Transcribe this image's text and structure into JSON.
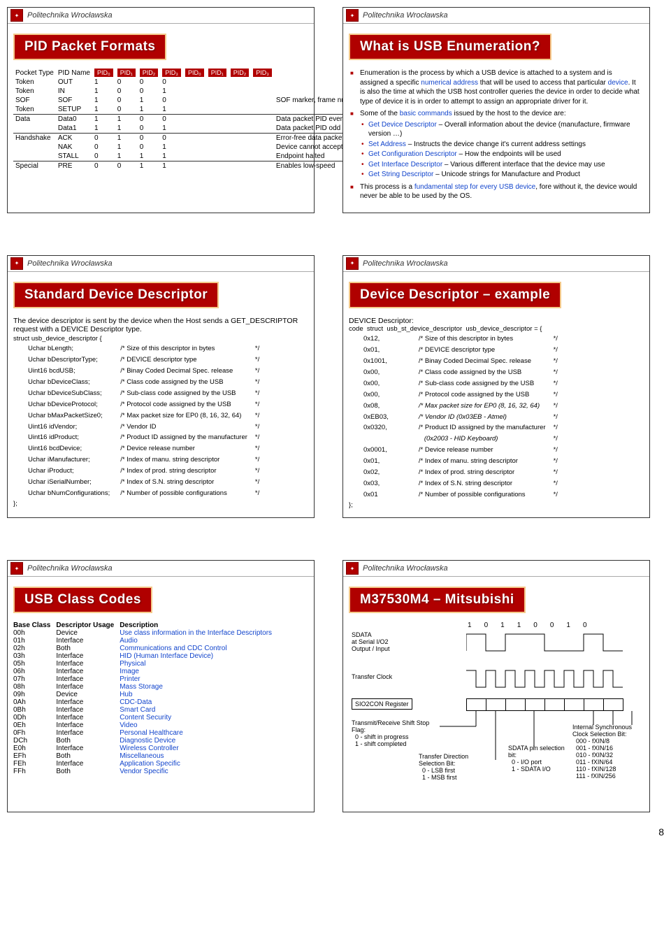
{
  "institution": "Politechnika Wrocławska",
  "page_number": "8",
  "slide1": {
    "title": "PID Packet Formats",
    "col_pt": "Pocket Type",
    "col_pid": "PID Name",
    "pid_headers": [
      "PID₀",
      "PID₁",
      "PID₂",
      "PID₃",
      "PID₀",
      "PID₁",
      "PID₂",
      "PID₃"
    ],
    "rows": [
      {
        "t": "Token",
        "n": "OUT",
        "b": [
          "1",
          "0",
          "0",
          "0"
        ],
        "d": ""
      },
      {
        "t": "Token",
        "n": "IN",
        "b": [
          "1",
          "0",
          "0",
          "1"
        ],
        "d": ""
      },
      {
        "t": "SOF",
        "n": "SOF",
        "b": [
          "1",
          "0",
          "1",
          "0"
        ],
        "d": "SOF marker, frame number"
      },
      {
        "t": "Token",
        "n": "SETUP",
        "b": [
          "1",
          "0",
          "1",
          "1"
        ],
        "d": ""
      },
      {
        "t": "Data",
        "n": "Data0",
        "b": [
          "1",
          "1",
          "0",
          "0"
        ],
        "d": "Data packet PID even"
      },
      {
        "t": "",
        "n": "Data1",
        "b": [
          "1",
          "1",
          "0",
          "1"
        ],
        "d": "Data packet PID odd"
      },
      {
        "t": "Handshake",
        "n": "ACK",
        "b": [
          "0",
          "1",
          "0",
          "0"
        ],
        "d": "Error-free data packet"
      },
      {
        "t": "",
        "n": "NAK",
        "b": [
          "0",
          "1",
          "0",
          "1"
        ],
        "d": "Device cannot accept or send data"
      },
      {
        "t": "",
        "n": "STALL",
        "b": [
          "0",
          "1",
          "1",
          "1"
        ],
        "d": "Endpoint halted"
      },
      {
        "t": "Special",
        "n": "PRE",
        "b": [
          "0",
          "0",
          "1",
          "1"
        ],
        "d": "Enables low-speed"
      }
    ]
  },
  "slide2": {
    "title": "What is USB Enumeration?",
    "para1_a": "Enumeration is the process by which a USB device is attached to a system and is assigned a specific ",
    "para1_b": "numerical address",
    "para1_c": " that will be used to access that particular ",
    "para1_d": "device",
    "para1_e": ". It is also the time at which the USB host controller queries the device in order to decide what type of device it is in order to attempt to assign an appropriate driver for it.",
    "para2_a": "Some of the ",
    "para2_b": "basic commands",
    "para2_c": " issued by the host to the device are:",
    "cmds": [
      {
        "k": "Get Device Descriptor",
        "v": " – Overall information about the device (manufacture, firmware version …)"
      },
      {
        "k": "Set Address",
        "v": " – Instructs the device change it's current address settings"
      },
      {
        "k": "Get Configuration Descriptor",
        "v": " – How the endpoints will be used"
      },
      {
        "k": "Get Interface Descriptor",
        "v": " – Various different interface that the device may use"
      },
      {
        "k": "Get String Descriptor",
        "v": " – Unicode strings for Manufacture and Product"
      }
    ],
    "para3_a": "This process is a ",
    "para3_b": "fundamental step for every USB device",
    "para3_c": ", fore without it, the device would never be able to be used by the OS."
  },
  "slide3": {
    "title": "Standard Device Descriptor",
    "intro": "The device descriptor is sent by the device when the Host sends a GET_DESCRIPTOR request with a DEVICE Descriptor type.",
    "struct_open": "struct usb_device_descriptor {",
    "fields": [
      {
        "n": "Uchar bLength;",
        "c": "/* Size of this descriptor in bytes"
      },
      {
        "n": "Uchar bDescriptorType;",
        "c": "/* DEVICE descriptor type"
      },
      {
        "n": "Uint16 bcdUSB;",
        "c": "/* Binay Coded Decimal Spec. release"
      },
      {
        "n": "Uchar bDeviceClass;",
        "c": "/* Class code assigned by the USB"
      },
      {
        "n": "Uchar bDeviceSubClass;",
        "c": "/* Sub-class code assigned by the USB"
      },
      {
        "n": "Uchar bDeviceProtocol;",
        "c": "/* Protocol code assigned by the USB"
      },
      {
        "n": "Uchar bMaxPacketSize0;",
        "c": "/* Max packet size for EP0 (8, 16, 32, 64)"
      },
      {
        "n": "Uint16 idVendor;",
        "c": "/* Vendor ID"
      },
      {
        "n": "Uint16 idProduct;",
        "c": "/* Product ID assigned by the manufacturer"
      },
      {
        "n": "Uint16 bcdDevice;",
        "c": "/* Device release number"
      },
      {
        "n": "Uchar iManufacturer;",
        "c": "/* Index of manu. string descriptor"
      },
      {
        "n": "Uchar iProduct;",
        "c": "/* Index of prod. string descriptor"
      },
      {
        "n": "Uchar iSerialNumber;",
        "c": "/* Index of S.N. string descriptor"
      },
      {
        "n": "Uchar bNumConfigurations;",
        "c": "/* Number of possible configurations"
      }
    ],
    "struct_close": "};"
  },
  "slide4": {
    "title": "Device Descriptor – example",
    "head": "DEVICE Descriptor:",
    "struct_open": "code  struct  usb_st_device_descriptor  usb_device_descriptor = {",
    "rows": [
      {
        "v": "0x12,",
        "c": "/* Size of this descriptor in bytes"
      },
      {
        "v": "0x01,",
        "c": "/* DEVICE descriptor type"
      },
      {
        "v": "0x1001,",
        "c": "/* Binay Coded Decimal Spec. release"
      },
      {
        "v": "0x00,",
        "c": "/* Class code assigned by the USB"
      },
      {
        "v": "0x00,",
        "c": "/* Sub-class code assigned by the USB"
      },
      {
        "v": "0x00,",
        "c": "/* Protocol code assigned by the USB"
      },
      {
        "v": "0x08,",
        "c": "/* Max packet size for EP0 (8, 16, 32, 64)"
      },
      {
        "v": "0xEB03,",
        "c": "/* Vendor ID (0x03EB - Atmel)"
      },
      {
        "v": "0x0320,",
        "c": "/* Product ID assigned by the manufacturer"
      },
      {
        "v": "",
        "c": "   (0x2003 - HID Keyboard)"
      },
      {
        "v": "0x0001,",
        "c": "/* Device release number"
      },
      {
        "v": "0x01,",
        "c": "/* Index of manu. string descriptor"
      },
      {
        "v": "0x02,",
        "c": "/* Index of prod. string descriptor"
      },
      {
        "v": "0x03,",
        "c": "/* Index of S.N. string descriptor"
      },
      {
        "v": "0x01",
        "c": "/* Number of possible configurations"
      }
    ],
    "struct_close": "};"
  },
  "slide5": {
    "title": "USB Class Codes",
    "h1": "Base Class",
    "h2": "Descriptor Usage",
    "h3": "Description",
    "rows": [
      {
        "c": "00h",
        "u": "Device",
        "d": "Use class information in the Interface Descriptors"
      },
      {
        "c": "01h",
        "u": "Interface",
        "d": "Audio"
      },
      {
        "c": "02h",
        "u": "Both",
        "d": "Communications and CDC Control"
      },
      {
        "c": "03h",
        "u": "Interface",
        "d": "HID (Human Interface Device)"
      },
      {
        "c": "05h",
        "u": "Interface",
        "d": "Physical"
      },
      {
        "c": "06h",
        "u": "Interface",
        "d": "Image"
      },
      {
        "c": "07h",
        "u": "Interface",
        "d": "Printer"
      },
      {
        "c": "08h",
        "u": "Interface",
        "d": "Mass Storage"
      },
      {
        "c": "09h",
        "u": "Device",
        "d": "Hub"
      },
      {
        "c": "0Ah",
        "u": "Interface",
        "d": "CDC-Data"
      },
      {
        "c": "0Bh",
        "u": "Interface",
        "d": "Smart Card"
      },
      {
        "c": "0Dh",
        "u": "Interface",
        "d": "Content Security"
      },
      {
        "c": "0Eh",
        "u": "Interface",
        "d": "Video"
      },
      {
        "c": "0Fh",
        "u": "Interface",
        "d": "Personal Healthcare"
      },
      {
        "c": "DCh",
        "u": "Both",
        "d": "Diagnostic Device"
      },
      {
        "c": "E0h",
        "u": "Interface",
        "d": "Wireless Controller"
      },
      {
        "c": "EFh",
        "u": "Both",
        "d": "Miscellaneous"
      },
      {
        "c": "FEh",
        "u": "Interface",
        "d": "Application Specific"
      },
      {
        "c": "FFh",
        "u": "Both",
        "d": "Vendor Specific"
      }
    ]
  },
  "slide6": {
    "title": "M37530M4 – Mitsubishi",
    "bits": [
      "1",
      "0",
      "1",
      "1",
      "0",
      "0",
      "1",
      "0"
    ],
    "l_sdata": "SDATA",
    "l_serial": "at Serial I/O2",
    "l_oi": "Output / Input",
    "l_tclk": "Transfer Clock",
    "l_reg": "SIO2CON Register",
    "l_trsf": "Transmit/Receive Shift Stop Flag:",
    "l_trsf0": "0 - shift in progress",
    "l_trsf1": "1 - shift completed",
    "l_dir": "Transfer Direction Selection Bit:",
    "l_dir0": "0 - LSB first",
    "l_dir1": "1 - MSB first",
    "l_pin": "SDATA pin selection bit:",
    "l_pin0": "0 - I/O port",
    "l_pin1": "1 - SDATA I/O",
    "l_clk": "Internal Synchronous Clock Selection Bit:",
    "l_clk0": "000 - fXIN/8",
    "l_clk1": "001 - fXIN/16",
    "l_clk2": "010 - fXIN/32",
    "l_clk3": "011 - fXIN/64",
    "l_clk4": "110 - fXIN/128",
    "l_clk5": "111 - fXIN/256"
  }
}
